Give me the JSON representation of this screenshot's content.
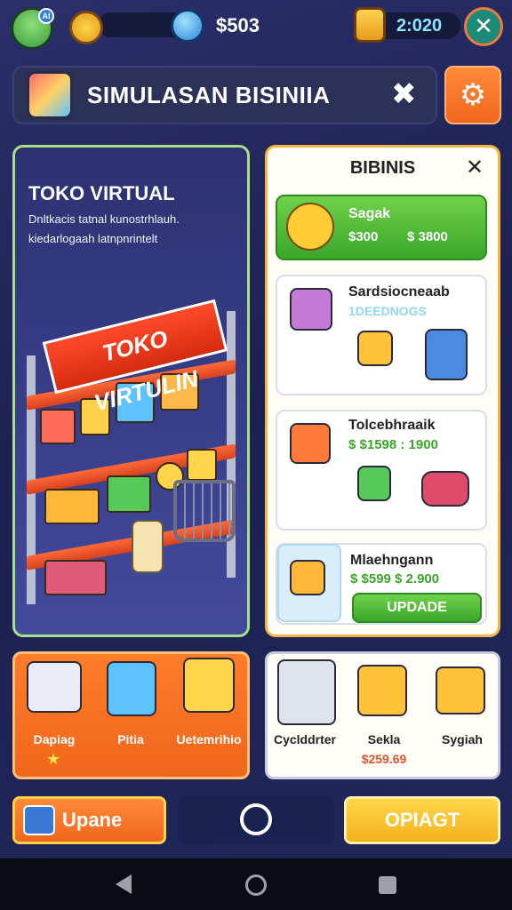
{
  "hud": {
    "money": "$503",
    "timer": "2:020",
    "avatar_badge": "AI"
  },
  "header": {
    "title": "SIMULASAN BISINIIA",
    "settings_icon": "gear-icon"
  },
  "store_panel": {
    "title": "TOKO VIRTUAL",
    "description": "Dnltkacis tatnal kunostrhlauh. kiedarlogaah latnpnrintelt",
    "banner": "TOKO VIRTULIN"
  },
  "business_panel": {
    "title": "BIBINIS",
    "cards": [
      {
        "title": "Sagak",
        "price": "$300",
        "cost": "$ 3800"
      },
      {
        "title": "Sardsiocneaab",
        "subtitle": "1DEEDNOGS"
      },
      {
        "title": "Tolcebhraaik",
        "price": "$ $1598 : 1900"
      },
      {
        "title": "Mlaehngann",
        "price": "$ $599 $ 2.900",
        "button": "UPDADE"
      }
    ]
  },
  "bottom_left": {
    "items": [
      {
        "label": "Dapiag"
      },
      {
        "label": "Pitia"
      },
      {
        "label": "Uetemrihio"
      }
    ]
  },
  "bottom_right": {
    "items": [
      {
        "label": "Cyclddrter"
      },
      {
        "label": "Sekla",
        "price": "$259.69"
      },
      {
        "label": "Sygiah"
      }
    ]
  },
  "actions": {
    "left_button": "Upane",
    "right_button": "OPIAGT"
  },
  "colors": {
    "accent_orange": "#f0661c",
    "accent_green": "#3aa62a",
    "accent_yellow": "#f3b21c",
    "background": "#1c2150"
  }
}
